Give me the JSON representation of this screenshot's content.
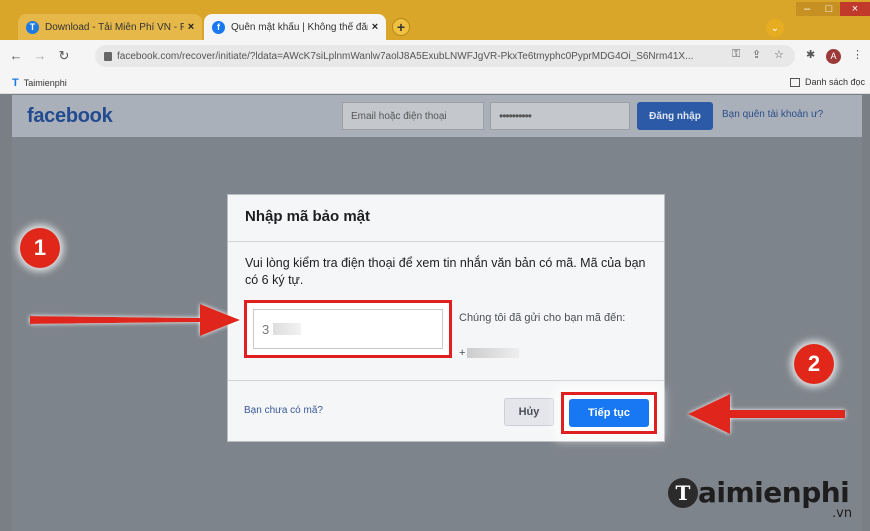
{
  "browser": {
    "tabs": [
      {
        "title": "Download - Tải Miễn Phí VN - Ph",
        "close": "×",
        "favicon": "T"
      },
      {
        "title": "Quên mật khẩu | Không thể đăng",
        "close": "×",
        "favicon": "f"
      }
    ],
    "new_tab": "+",
    "url": "facebook.com/recover/initiate/?ldata=AWcK7siLplnmWanlw7aolJ8A5ExubLNWFJgVR-PkxTe6tmyphc0PyprMDG4Oi_S6Nrm41X...",
    "window_controls": {
      "minimize": "–",
      "maximize": "□",
      "close": "×"
    }
  },
  "bookmarks": {
    "left_item": "Taimienphi",
    "right_item": "Danh sách đọc"
  },
  "facebook": {
    "logo": "facebook",
    "email_placeholder": "Email hoặc điện thoại",
    "password_dots": "••••••••••",
    "login_button": "Đăng nhập",
    "forgot_link": "Bạn quên tài khoản ư?"
  },
  "dialog": {
    "title": "Nhập mã bảo mật",
    "message": "Vui lòng kiểm tra điện thoại để xem tin nhắn văn bản có mã. Mã của bạn có 6 ký tự.",
    "code_value": "3",
    "sent_message": "Chúng tôi đã gửi cho bạn mã đến:",
    "sent_number_prefix": "+",
    "no_code_link": "Bạn chưa có mã?",
    "cancel_button": "Hủy",
    "continue_button": "Tiếp tục"
  },
  "annotations": {
    "badge1": "1",
    "badge2": "2",
    "arrow_color": "#e0271a"
  },
  "watermark": {
    "logo_letter": "T",
    "text": "aimienphi",
    "suffix": ".vn"
  }
}
